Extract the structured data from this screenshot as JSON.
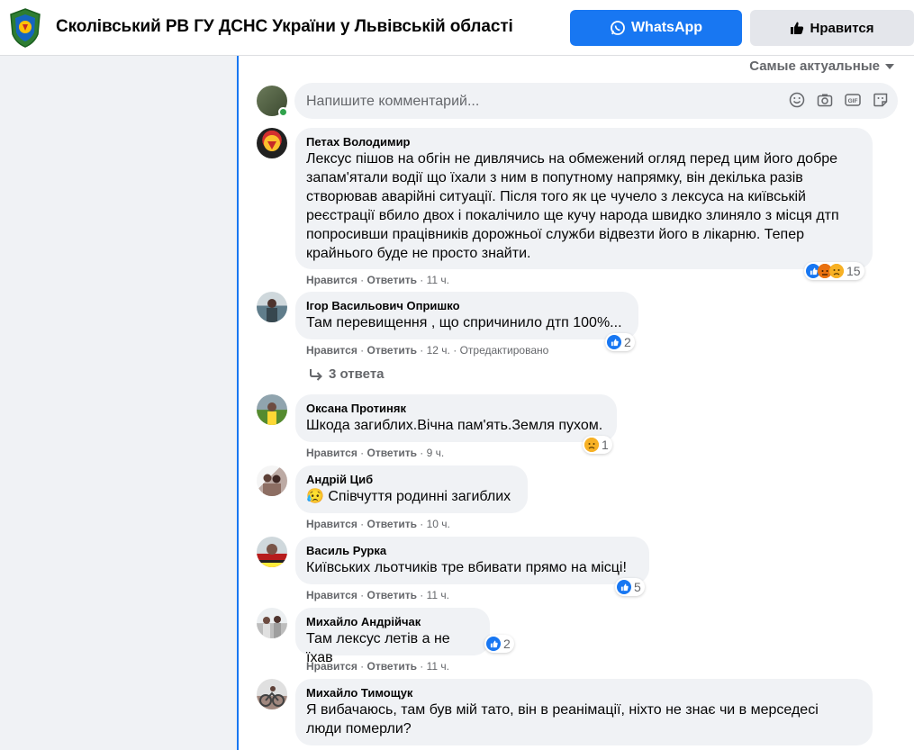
{
  "header": {
    "page_name": "Сколівський РВ ГУ ДСНС України у Львівській області",
    "whatsapp_label": "WhatsApp",
    "like_label": "Нравится"
  },
  "sort": {
    "label": "Самые актуальные"
  },
  "composer": {
    "placeholder": "Напишите комментарий..."
  },
  "comments": [
    {
      "author": "Петах Володимир",
      "lines": [
        "Лексус пішов на обгін не дивлячись на обмежений огляд перед цим його добре",
        "запам'ятали водії що їхали з ним в попутному напрямку, він декілька разів",
        "створював аварійні ситуації. Після того як це чучело з лексуса на київській",
        "реєстрації вбило двох і покалічило ще кучу народа швидко злиняло з місця дтп",
        "попросивши працівників дорожньої служби відвезти його в лікарню. Тепер",
        "крайнього буде не просто знайти."
      ],
      "like": "Нравится",
      "reply": "Ответить",
      "time": "11 ч.",
      "react_count": "15"
    },
    {
      "author": "Ігор Васильович Опришко",
      "lines": [
        "Там перевищення , що спричинило дтп 100%..."
      ],
      "like": "Нравится",
      "reply": "Ответить",
      "time": "12 ч.",
      "edited": "Отредактировано",
      "react_count": "2",
      "replies_label": "3 ответа"
    },
    {
      "author": "Оксана Протиняк",
      "lines": [
        "Шкода загиблих.Вічна пам'ять.Земля пухом."
      ],
      "like": "Нравится",
      "reply": "Ответить",
      "time": "9 ч.",
      "react_count": "1"
    },
    {
      "author": "Андрій Циб",
      "lines": [
        "😥 Співчуття родинні загиблих"
      ],
      "like": "Нравится",
      "reply": "Ответить",
      "time": "10 ч."
    },
    {
      "author": "Василь Рурка",
      "lines": [
        "Київських льотчиків тре вбивати прямо на місці!"
      ],
      "like": "Нравится",
      "reply": "Ответить",
      "time": "11 ч.",
      "react_count": "5"
    },
    {
      "author": "Михайло Андрійчак",
      "lines": [
        "Там лексус летів а не їхав"
      ],
      "like": "Нравится",
      "reply": "Ответить",
      "time": "11 ч.",
      "react_count": "2"
    },
    {
      "author": "Михайло Тимощук",
      "lines": [
        "Я вибачаюсь, там був мій тато, він в реанімації, ніхто не знає чи в мерседесі",
        "люди померли?"
      ]
    }
  ],
  "colors": {
    "brand_blue": "#1877f2",
    "bubble_bg": "#f0f2f5",
    "muted_text": "#65676b"
  }
}
